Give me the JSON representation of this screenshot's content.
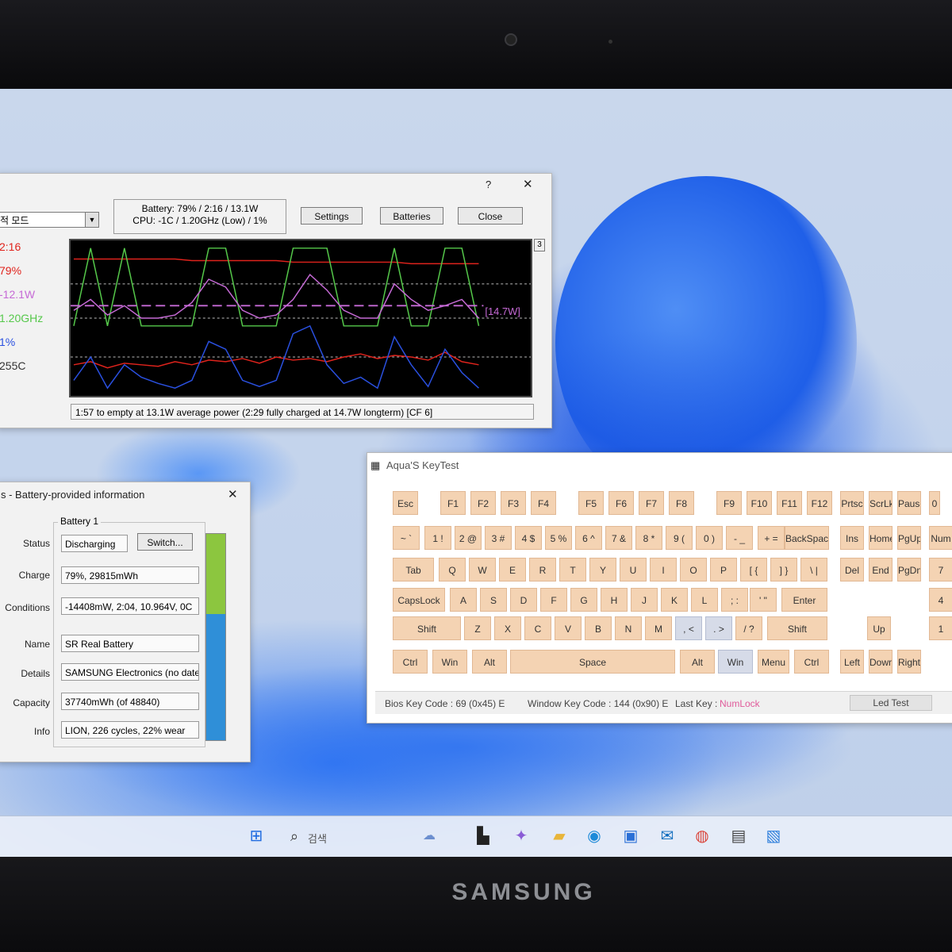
{
  "device": {
    "brand": "SAMSUNG"
  },
  "battery_bar": {
    "mode_combo": "적 모드",
    "help": "?",
    "close_x": "✕",
    "status_line1": "Battery: 79% / 2:16 / 13.1W",
    "status_line2": "CPU: -1C / 1.20GHz (Low) / 1%",
    "buttons": {
      "settings": "Settings",
      "batteries": "Batteries",
      "close": "Close"
    },
    "side_values": [
      {
        "text": "2:16",
        "color": "#e0231c"
      },
      {
        "text": "79%",
        "color": "#e0231c"
      },
      {
        "text": "-12.1W",
        "color": "#c66ad6"
      },
      {
        "text": "1.20GHz",
        "color": "#55c84a"
      },
      {
        "text": "1%",
        "color": "#2a50e0"
      },
      {
        "text": "255C",
        "color": "#333333"
      }
    ],
    "graph_scale": "3",
    "graph_label": "[14.7W]",
    "statusbar": "1:57 to empty at 13.1W average power (2:29 fully charged at 14.7W longterm) [CF 6]"
  },
  "battery_info": {
    "title": "s - Battery-provided information",
    "close_x": "✕",
    "group_label": "Battery 1",
    "rows": [
      {
        "label": "Status",
        "value": "Discharging"
      },
      {
        "label": "Charge",
        "value": "79%, 29815mWh"
      },
      {
        "label": "Conditions",
        "value": "-14408mW, 2:04, 10.964V, 0C"
      },
      {
        "label": "Name",
        "value": "SR Real Battery"
      },
      {
        "label": "Details",
        "value": "SAMSUNG Electronics (no date)"
      },
      {
        "label": "Capacity",
        "value": "37740mWh (of 48840)"
      },
      {
        "label": "Info",
        "value": "LION, 226 cycles, 22% wear"
      }
    ],
    "switch_button": "Switch...",
    "charge_fraction": 0.79
  },
  "keytest": {
    "title": "Aqua'S KeyTest",
    "row_fn": [
      "Esc",
      "F1",
      "F2",
      "F3",
      "F4",
      "F5",
      "F6",
      "F7",
      "F8",
      "F9",
      "F10",
      "F11",
      "F12",
      "Prtsc",
      "ScrLk",
      "Pause",
      "0"
    ],
    "row_num": [
      "~ `",
      "1 !",
      "2 @",
      "3 #",
      "4 $",
      "5 %",
      "6 ^",
      "7 &",
      "8 *",
      "9 (",
      "0 )",
      "- _",
      "+ =",
      "BackSpace",
      "Ins",
      "Home",
      "PgUp",
      "Num"
    ],
    "row_tab": [
      "Tab",
      "Q",
      "W",
      "E",
      "R",
      "T",
      "Y",
      "U",
      "I",
      "O",
      "P",
      "[ {",
      "] }",
      "\\ |",
      "Del",
      "End",
      "PgDn",
      "7"
    ],
    "row_caps": [
      "CapsLock",
      "A",
      "S",
      "D",
      "F",
      "G",
      "H",
      "J",
      "K",
      "L",
      "; :",
      "' \"",
      "Enter",
      "4"
    ],
    "row_shift": [
      "Shift",
      "Z",
      "X",
      "C",
      "V",
      "B",
      "N",
      "M",
      ", <",
      ". >",
      "/ ?",
      "Shift",
      "Up",
      "1"
    ],
    "row_ctrl": [
      "Ctrl",
      "Win",
      "Alt",
      "Space",
      "Alt",
      "Win",
      "Menu",
      "Ctrl",
      "Left",
      "Down",
      "Right"
    ],
    "status": {
      "bios": "Bios Key Code : 69 (0x45) E",
      "window": "Window Key Code : 144 (0x90) E",
      "last_label": "Last Key :",
      "last_value": "NumLock",
      "led_test": "Led Test"
    }
  },
  "taskbar": {
    "search_text": "검색",
    "icons": [
      "windows-start-icon",
      "search-icon",
      "widgets-icon",
      "task-view-icon",
      "copilot-icon",
      "file-explorer-icon",
      "edge-icon",
      "store-icon",
      "outlook-icon",
      "chrome-icon",
      "notepad-icon",
      "paint-icon"
    ]
  },
  "chart_data": {
    "type": "line",
    "series": [
      {
        "color": "#e0231c",
        "values": [
          0.88,
          0.88,
          0.88,
          0.88,
          0.88,
          0.88,
          0.88,
          0.87,
          0.87,
          0.87,
          0.87,
          0.87,
          0.87,
          0.86,
          0.86,
          0.86,
          0.86,
          0.86,
          0.86,
          0.86,
          0.85,
          0.85,
          0.85,
          0.85,
          0.85
        ]
      },
      {
        "color": "#e0231c",
        "values": [
          0.2,
          0.22,
          0.18,
          0.21,
          0.2,
          0.19,
          0.22,
          0.2,
          0.23,
          0.22,
          0.24,
          0.21,
          0.25,
          0.23,
          0.24,
          0.22,
          0.25,
          0.27,
          0.24,
          0.26,
          0.25,
          0.23,
          0.28,
          0.22,
          0.2
        ]
      },
      {
        "color": "#55c84a",
        "values": [
          0.45,
          0.95,
          0.45,
          0.95,
          0.45,
          0.45,
          0.45,
          0.45,
          0.95,
          0.95,
          0.45,
          0.45,
          0.45,
          0.95,
          0.95,
          0.95,
          0.45,
          0.45,
          0.45,
          0.95,
          0.45,
          0.45,
          0.95,
          0.95,
          0.45
        ]
      },
      {
        "color": "#c66ad6",
        "values": [
          0.55,
          0.62,
          0.52,
          0.58,
          0.5,
          0.5,
          0.52,
          0.6,
          0.75,
          0.7,
          0.55,
          0.5,
          0.52,
          0.62,
          0.78,
          0.68,
          0.55,
          0.5,
          0.5,
          0.72,
          0.62,
          0.55,
          0.58,
          0.62,
          0.5
        ]
      },
      {
        "color": "#2a50e0",
        "values": [
          0.1,
          0.25,
          0.05,
          0.2,
          0.12,
          0.08,
          0.05,
          0.1,
          0.35,
          0.3,
          0.1,
          0.06,
          0.1,
          0.4,
          0.45,
          0.2,
          0.08,
          0.12,
          0.05,
          0.38,
          0.2,
          0.06,
          0.3,
          0.15,
          0.05
        ]
      }
    ],
    "reference_lines": [
      0.72,
      0.5,
      0.25
    ]
  }
}
